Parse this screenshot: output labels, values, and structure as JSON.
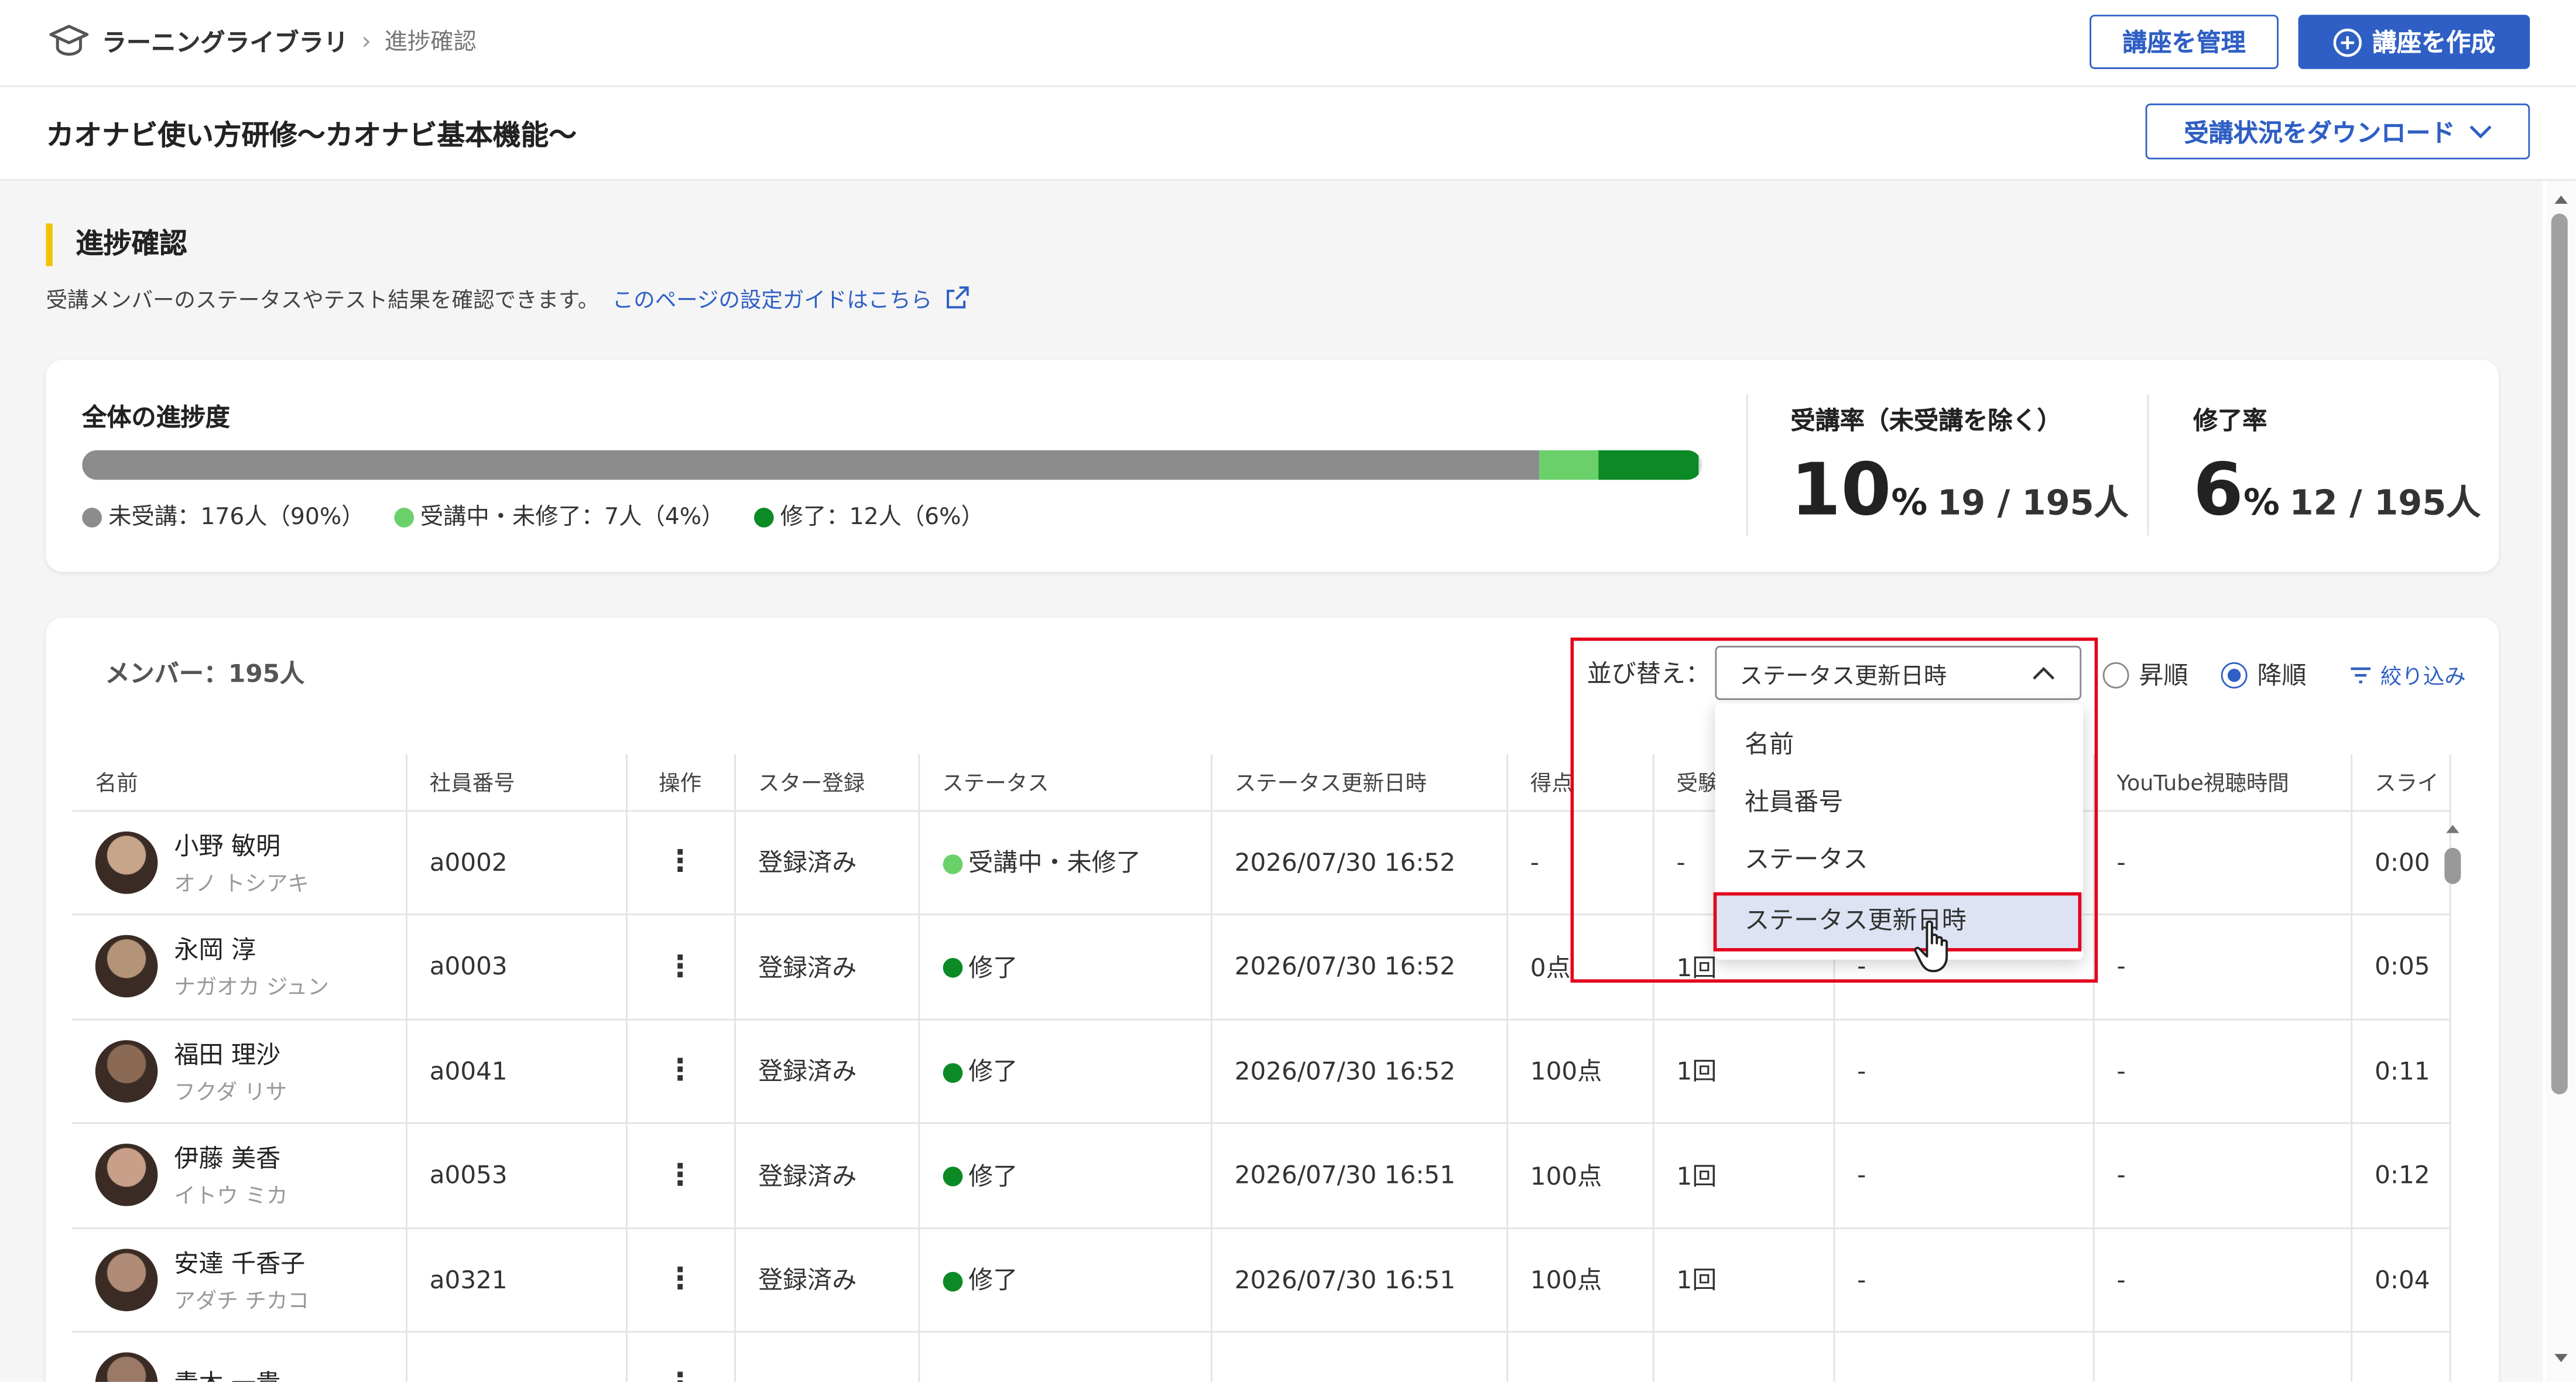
{
  "breadcrumb": {
    "root": "ラーニングライブラリ",
    "separator": "›",
    "current": "進捗確認"
  },
  "header": {
    "manage_button": "講座を管理",
    "create_button": "講座を作成"
  },
  "course": {
    "title": "カオナビ使い方研修〜カオナビ基本機能〜",
    "download_button": "受講状況をダウンロード"
  },
  "section": {
    "title": "進捗確認",
    "description": "受講メンバーのステータスやテスト結果を確認できます。",
    "guide_link": "このページの設定ガイドはこちら"
  },
  "progress": {
    "title": "全体の進捗度",
    "segments": [
      {
        "label": "未受講：176人（90%）",
        "fraction": 0.9,
        "color": "#8c8c8c"
      },
      {
        "label": "受講中・未修了：7人（4%）",
        "fraction": 0.036,
        "color": "#6ad16a"
      },
      {
        "label": "修了：12人（6%）",
        "fraction": 0.062,
        "color": "#0c8a25"
      }
    ]
  },
  "stats": {
    "attendance": {
      "label": "受講率（未受講を除く）",
      "value": "10",
      "unit": "%",
      "fraction": "19 / 195人"
    },
    "completion": {
      "label": "修了率",
      "value": "6",
      "unit": "%",
      "fraction": "12 / 195人"
    }
  },
  "members": {
    "count_label": "メンバー：195人",
    "sort_label": "並び替え：",
    "sort_value": "ステータス更新日時",
    "asc_label": "昇順",
    "desc_label": "降順",
    "filter_label": "絞り込み",
    "sort_options": [
      "名前",
      "社員番号",
      "ステータス",
      "ステータス更新日時"
    ],
    "columns": [
      "名前",
      "社員番号",
      "操作",
      "スター登録",
      "ステータス",
      "ステータス更新日時",
      "得点",
      "受験",
      "",
      "YouTube視聴時間",
      "スライ"
    ],
    "rows": [
      {
        "name": "小野 敏明",
        "kana": "オノ トシアキ",
        "id": "a0002",
        "star": "登録済み",
        "status": "受講中・未修了",
        "status_color": "#6ad16a",
        "updated": "2026/07/30 16:52",
        "score": "-",
        "tries": "-",
        "c9": "",
        "yt": "-",
        "slide": "0:00"
      },
      {
        "name": "永岡 淳",
        "kana": "ナガオカ ジュン",
        "id": "a0003",
        "star": "登録済み",
        "status": "修了",
        "status_color": "#0c8a25",
        "updated": "2026/07/30 16:52",
        "score": "0点",
        "tries": "1回",
        "c9": "-",
        "yt": "-",
        "slide": "0:05"
      },
      {
        "name": "福田 理沙",
        "kana": "フクダ リサ",
        "id": "a0041",
        "star": "登録済み",
        "status": "修了",
        "status_color": "#0c8a25",
        "updated": "2026/07/30 16:52",
        "score": "100点",
        "tries": "1回",
        "c9": "-",
        "yt": "-",
        "slide": "0:11"
      },
      {
        "name": "伊藤 美香",
        "kana": "イトウ ミカ",
        "id": "a0053",
        "star": "登録済み",
        "status": "修了",
        "status_color": "#0c8a25",
        "updated": "2026/07/30 16:51",
        "score": "100点",
        "tries": "1回",
        "c9": "-",
        "yt": "-",
        "slide": "0:12"
      },
      {
        "name": "安達 千香子",
        "kana": "アダチ チカコ",
        "id": "a0321",
        "star": "登録済み",
        "status": "修了",
        "status_color": "#0c8a25",
        "updated": "2026/07/30 16:51",
        "score": "100点",
        "tries": "1回",
        "c9": "-",
        "yt": "-",
        "slide": "0:04"
      },
      {
        "name": "青木 一貴",
        "kana": "",
        "id": "",
        "star": "",
        "status": "",
        "status_color": "#0c8a25",
        "updated": "",
        "score": "",
        "tries": "",
        "c9": "",
        "yt": "",
        "slide": ""
      }
    ]
  },
  "colors": {
    "accent": "#2f5fc4",
    "highlight": "#e3001b",
    "section_bar": "#f2c200"
  }
}
